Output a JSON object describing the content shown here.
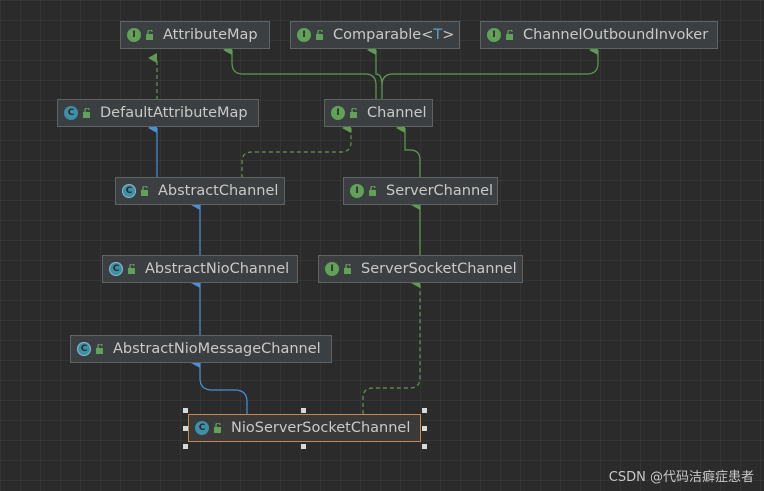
{
  "diagram": {
    "nodes": [
      {
        "id": "attribute-map",
        "label": "AttributeMap",
        "kind": "interface",
        "kind_letter": "I"
      },
      {
        "id": "comparable",
        "label": "Comparable<",
        "generic": "T",
        "label_end": ">",
        "kind": "interface",
        "kind_letter": "I"
      },
      {
        "id": "channel-outbound-invoker",
        "label": "ChannelOutboundInvoker",
        "kind": "interface",
        "kind_letter": "I"
      },
      {
        "id": "default-attribute-map",
        "label": "DefaultAttributeMap",
        "kind": "class",
        "kind_letter": "C"
      },
      {
        "id": "channel",
        "label": "Channel",
        "kind": "interface",
        "kind_letter": "I"
      },
      {
        "id": "abstract-channel",
        "label": "AbstractChannel",
        "kind": "abstract-class",
        "kind_letter": "C"
      },
      {
        "id": "server-channel",
        "label": "ServerChannel",
        "kind": "interface",
        "kind_letter": "I"
      },
      {
        "id": "abstract-nio-channel",
        "label": "AbstractNioChannel",
        "kind": "abstract-class",
        "kind_letter": "C"
      },
      {
        "id": "server-socket-channel",
        "label": "ServerSocketChannel",
        "kind": "interface",
        "kind_letter": "I"
      },
      {
        "id": "abstract-nio-message-channel",
        "label": "AbstractNioMessageChannel",
        "kind": "abstract-class",
        "kind_letter": "C"
      },
      {
        "id": "nio-server-socket-channel",
        "label": "NioServerSocketChannel",
        "kind": "class",
        "kind_letter": "C",
        "selected": true
      }
    ],
    "edges": [
      {
        "from": "default-attribute-map",
        "to": "attribute-map",
        "type": "implements"
      },
      {
        "from": "channel",
        "to": "attribute-map",
        "type": "extends-interface"
      },
      {
        "from": "channel",
        "to": "comparable",
        "type": "extends-interface"
      },
      {
        "from": "channel",
        "to": "channel-outbound-invoker",
        "type": "extends-interface"
      },
      {
        "from": "abstract-channel",
        "to": "default-attribute-map",
        "type": "extends"
      },
      {
        "from": "abstract-channel",
        "to": "channel",
        "type": "implements"
      },
      {
        "from": "server-channel",
        "to": "channel",
        "type": "extends-interface"
      },
      {
        "from": "abstract-nio-channel",
        "to": "abstract-channel",
        "type": "extends"
      },
      {
        "from": "server-socket-channel",
        "to": "server-channel",
        "type": "extends-interface"
      },
      {
        "from": "abstract-nio-message-channel",
        "to": "abstract-nio-channel",
        "type": "extends"
      },
      {
        "from": "nio-server-socket-channel",
        "to": "abstract-nio-message-channel",
        "type": "extends"
      },
      {
        "from": "nio-server-socket-channel",
        "to": "server-socket-channel",
        "type": "implements"
      }
    ]
  },
  "colors": {
    "background": "#2b2b2b",
    "interface_badge": "#62a158",
    "class_badge": "#3e8fa8",
    "extends_edge": "#4a90d9",
    "interface_edge": "#5f9c4f",
    "selection": "#c9874c"
  },
  "watermark": "CSDN @代码洁癖症患者"
}
